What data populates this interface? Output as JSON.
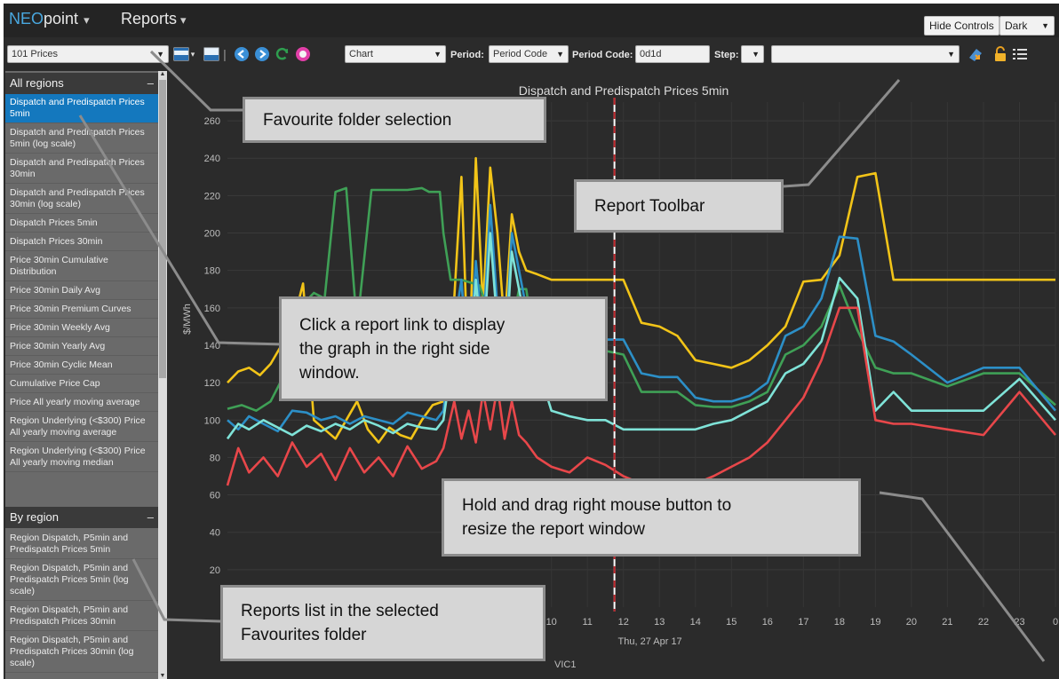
{
  "app": {
    "brand_neo": "NEO",
    "brand_point": "point",
    "reports_menu": "Reports",
    "hide_controls": "Hide Controls",
    "theme": "Dark"
  },
  "toolbar": {
    "folder": "101 Prices",
    "view_select": "Chart",
    "period_label": "Period:",
    "period_value": "Period Code",
    "period_code_label": "Period Code:",
    "period_code_value": "0d1d",
    "step_label": "Step:",
    "step_value": "",
    "region_value": ""
  },
  "sidebar": {
    "all_regions": {
      "title": "All regions",
      "items": [
        "Dispatch and Predispatch Prices 5min",
        "Dispatch and Predispatch Prices 5min (log scale)",
        "Dispatch and Predispatch Prices 30min",
        "Dispatch and Predispatch Prices 30min (log scale)",
        "Dispatch Prices 5min",
        "Dispatch Prices 30min",
        "Price 30min Cumulative Distribution",
        "Price 30min Daily Avg",
        "Price 30min Premium Curves",
        "Price 30min Weekly Avg",
        "Price 30min Yearly Avg",
        "Price 30min Cyclic Mean",
        "Cumulative Price Cap",
        "Price All yearly moving average",
        "Region Underlying (<$300) Price All yearly moving average",
        "Region Underlying (<$300) Price All yearly moving median"
      ]
    },
    "by_region": {
      "title": "By region",
      "items": [
        "Region Dispatch, P5min and Predispatch Prices 5min",
        "Region Dispatch, P5min and Predispatch Prices 5min (log scale)",
        "Region Dispatch, P5min and Predispatch Prices 30min",
        "Region Dispatch, P5min and Predispatch Prices 30min (log scale)"
      ]
    }
  },
  "chart_data": {
    "type": "line",
    "title": "Dispatch and Predispatch Prices 5min",
    "ylabel": "$/MWh",
    "ylim": [
      0,
      270
    ],
    "yticks": [
      20,
      40,
      60,
      80,
      100,
      120,
      140,
      160,
      180,
      200,
      220,
      240,
      260
    ],
    "xlim": [
      1,
      24
    ],
    "xticks": [
      {
        "x": 10,
        "label": "10"
      },
      {
        "x": 11,
        "label": "11"
      },
      {
        "x": 12,
        "label": "12"
      },
      {
        "x": 13,
        "label": "13"
      },
      {
        "x": 14,
        "label": "14"
      },
      {
        "x": 15,
        "label": "15"
      },
      {
        "x": 16,
        "label": "16"
      },
      {
        "x": 17,
        "label": "17"
      },
      {
        "x": 18,
        "label": "18"
      },
      {
        "x": 19,
        "label": "19"
      },
      {
        "x": 20,
        "label": "20"
      },
      {
        "x": 21,
        "label": "21"
      },
      {
        "x": 22,
        "label": "22"
      },
      {
        "x": 23,
        "label": "23"
      },
      {
        "x": 24,
        "label": "0"
      }
    ],
    "date_label": "Thu, 27 Apr 17",
    "footer_label": "VIC1",
    "now_marker_x": 11.75,
    "grid": true,
    "series": [
      {
        "color": "#f2c418",
        "points": [
          [
            1.0,
            120
          ],
          [
            1.3,
            126
          ],
          [
            1.6,
            128
          ],
          [
            1.9,
            124
          ],
          [
            2.2,
            130
          ],
          [
            2.5,
            140
          ],
          [
            2.8,
            150
          ],
          [
            3.1,
            173
          ],
          [
            3.4,
            100
          ],
          [
            3.7,
            95
          ],
          [
            4.0,
            90
          ],
          [
            4.3,
            100
          ],
          [
            4.6,
            110
          ],
          [
            4.9,
            95
          ],
          [
            5.2,
            88
          ],
          [
            5.5,
            96
          ],
          [
            5.8,
            92
          ],
          [
            6.1,
            90
          ],
          [
            6.4,
            100
          ],
          [
            6.7,
            108
          ],
          [
            7.0,
            110
          ],
          [
            7.3,
            165
          ],
          [
            7.5,
            230
          ],
          [
            7.7,
            120
          ],
          [
            7.9,
            240
          ],
          [
            8.1,
            160
          ],
          [
            8.3,
            235
          ],
          [
            8.5,
            200
          ],
          [
            8.7,
            150
          ],
          [
            8.9,
            210
          ],
          [
            9.1,
            190
          ],
          [
            9.3,
            180
          ],
          [
            9.6,
            178
          ],
          [
            10.0,
            175
          ],
          [
            10.5,
            175
          ],
          [
            11.0,
            175
          ],
          [
            11.5,
            175
          ],
          [
            12.0,
            175
          ],
          [
            12.5,
            152
          ],
          [
            13.0,
            150
          ],
          [
            13.5,
            145
          ],
          [
            14.0,
            132
          ],
          [
            14.5,
            130
          ],
          [
            15.0,
            128
          ],
          [
            15.5,
            132
          ],
          [
            16.0,
            140
          ],
          [
            16.5,
            150
          ],
          [
            17.0,
            174
          ],
          [
            17.5,
            175
          ],
          [
            18.0,
            188
          ],
          [
            18.5,
            230
          ],
          [
            19.0,
            232
          ],
          [
            19.5,
            175
          ],
          [
            20.0,
            175
          ],
          [
            21.0,
            175
          ],
          [
            22.0,
            175
          ],
          [
            23.0,
            175
          ],
          [
            24.0,
            175
          ]
        ]
      },
      {
        "color": "#3fa056",
        "points": [
          [
            1.0,
            106
          ],
          [
            1.4,
            108
          ],
          [
            1.8,
            105
          ],
          [
            2.2,
            110
          ],
          [
            2.6,
            125
          ],
          [
            3.0,
            160
          ],
          [
            3.4,
            168
          ],
          [
            3.7,
            165
          ],
          [
            4.0,
            222
          ],
          [
            4.3,
            224
          ],
          [
            4.6,
            150
          ],
          [
            5.0,
            223
          ],
          [
            5.5,
            223
          ],
          [
            6.0,
            223
          ],
          [
            6.4,
            224
          ],
          [
            6.6,
            222
          ],
          [
            6.9,
            222
          ],
          [
            7.0,
            200
          ],
          [
            7.2,
            175
          ],
          [
            7.5,
            175
          ],
          [
            8.0,
            172
          ],
          [
            8.3,
            155
          ],
          [
            8.7,
            130
          ],
          [
            9.1,
            170
          ],
          [
            9.3,
            170
          ],
          [
            9.5,
            145
          ],
          [
            9.8,
            140
          ],
          [
            10.2,
            140
          ],
          [
            10.6,
            140
          ],
          [
            11.0,
            137
          ],
          [
            11.5,
            137
          ],
          [
            12.0,
            135
          ],
          [
            12.5,
            115
          ],
          [
            13.0,
            115
          ],
          [
            13.5,
            115
          ],
          [
            14.0,
            108
          ],
          [
            14.5,
            107
          ],
          [
            15.0,
            107
          ],
          [
            15.5,
            110
          ],
          [
            16.0,
            115
          ],
          [
            16.5,
            135
          ],
          [
            17.0,
            140
          ],
          [
            17.5,
            150
          ],
          [
            18.0,
            172
          ],
          [
            18.5,
            148
          ],
          [
            19.0,
            128
          ],
          [
            19.5,
            125
          ],
          [
            20.0,
            125
          ],
          [
            21.0,
            118
          ],
          [
            22.0,
            125
          ],
          [
            23.0,
            125
          ],
          [
            24.0,
            108
          ]
        ]
      },
      {
        "color": "#2c8fc7",
        "points": [
          [
            1.0,
            100
          ],
          [
            1.3,
            95
          ],
          [
            1.6,
            102
          ],
          [
            2.0,
            98
          ],
          [
            2.4,
            94
          ],
          [
            2.8,
            105
          ],
          [
            3.2,
            104
          ],
          [
            3.6,
            100
          ],
          [
            4.0,
            102
          ],
          [
            4.4,
            98
          ],
          [
            4.8,
            102
          ],
          [
            5.2,
            100
          ],
          [
            5.6,
            98
          ],
          [
            6.0,
            104
          ],
          [
            6.4,
            102
          ],
          [
            6.8,
            100
          ],
          [
            7.0,
            105
          ],
          [
            7.3,
            150
          ],
          [
            7.5,
            175
          ],
          [
            7.7,
            120
          ],
          [
            7.9,
            185
          ],
          [
            8.1,
            145
          ],
          [
            8.3,
            215
          ],
          [
            8.5,
            160
          ],
          [
            8.7,
            130
          ],
          [
            8.9,
            200
          ],
          [
            9.1,
            180
          ],
          [
            9.3,
            160
          ],
          [
            9.6,
            140
          ],
          [
            10.0,
            145
          ],
          [
            10.5,
            148
          ],
          [
            11.0,
            143
          ],
          [
            11.5,
            143
          ],
          [
            12.0,
            143
          ],
          [
            12.5,
            125
          ],
          [
            13.0,
            123
          ],
          [
            13.5,
            123
          ],
          [
            14.0,
            112
          ],
          [
            14.5,
            110
          ],
          [
            15.0,
            110
          ],
          [
            15.5,
            113
          ],
          [
            16.0,
            120
          ],
          [
            16.5,
            145
          ],
          [
            17.0,
            150
          ],
          [
            17.5,
            165
          ],
          [
            18.0,
            198
          ],
          [
            18.5,
            197
          ],
          [
            19.0,
            145
          ],
          [
            19.5,
            142
          ],
          [
            20.0,
            135
          ],
          [
            21.0,
            120
          ],
          [
            22.0,
            128
          ],
          [
            23.0,
            128
          ],
          [
            24.0,
            105
          ]
        ]
      },
      {
        "color": "#7fe3d8",
        "points": [
          [
            1.0,
            90
          ],
          [
            1.3,
            98
          ],
          [
            1.6,
            95
          ],
          [
            2.0,
            100
          ],
          [
            2.4,
            96
          ],
          [
            2.8,
            92
          ],
          [
            3.2,
            97
          ],
          [
            3.6,
            94
          ],
          [
            4.0,
            98
          ],
          [
            4.4,
            95
          ],
          [
            4.8,
            100
          ],
          [
            5.2,
            97
          ],
          [
            5.6,
            93
          ],
          [
            6.0,
            98
          ],
          [
            6.4,
            96
          ],
          [
            6.8,
            95
          ],
          [
            7.0,
            100
          ],
          [
            7.3,
            140
          ],
          [
            7.5,
            160
          ],
          [
            7.7,
            115
          ],
          [
            7.9,
            175
          ],
          [
            8.1,
            135
          ],
          [
            8.3,
            200
          ],
          [
            8.5,
            150
          ],
          [
            8.7,
            125
          ],
          [
            8.9,
            190
          ],
          [
            9.1,
            170
          ],
          [
            9.3,
            150
          ],
          [
            9.6,
            130
          ],
          [
            10.0,
            105
          ],
          [
            10.5,
            102
          ],
          [
            11.0,
            100
          ],
          [
            11.5,
            100
          ],
          [
            12.0,
            95
          ],
          [
            12.5,
            95
          ],
          [
            13.0,
            95
          ],
          [
            13.5,
            95
          ],
          [
            14.0,
            95
          ],
          [
            14.5,
            98
          ],
          [
            15.0,
            100
          ],
          [
            15.5,
            105
          ],
          [
            16.0,
            110
          ],
          [
            16.5,
            125
          ],
          [
            17.0,
            130
          ],
          [
            17.5,
            142
          ],
          [
            18.0,
            176
          ],
          [
            18.5,
            165
          ],
          [
            19.0,
            105
          ],
          [
            19.5,
            115
          ],
          [
            20.0,
            105
          ],
          [
            21.0,
            105
          ],
          [
            22.0,
            105
          ],
          [
            23.0,
            122
          ],
          [
            24.0,
            100
          ]
        ]
      },
      {
        "color": "#e8474a",
        "points": [
          [
            1.0,
            65
          ],
          [
            1.3,
            85
          ],
          [
            1.6,
            72
          ],
          [
            2.0,
            80
          ],
          [
            2.4,
            70
          ],
          [
            2.8,
            88
          ],
          [
            3.2,
            75
          ],
          [
            3.6,
            82
          ],
          [
            4.0,
            68
          ],
          [
            4.4,
            85
          ],
          [
            4.8,
            72
          ],
          [
            5.2,
            80
          ],
          [
            5.6,
            70
          ],
          [
            6.0,
            86
          ],
          [
            6.4,
            74
          ],
          [
            6.8,
            78
          ],
          [
            7.0,
            85
          ],
          [
            7.3,
            110
          ],
          [
            7.5,
            90
          ],
          [
            7.7,
            105
          ],
          [
            7.9,
            88
          ],
          [
            8.1,
            115
          ],
          [
            8.3,
            95
          ],
          [
            8.5,
            118
          ],
          [
            8.7,
            90
          ],
          [
            8.9,
            110
          ],
          [
            9.1,
            92
          ],
          [
            9.3,
            88
          ],
          [
            9.6,
            80
          ],
          [
            10.0,
            75
          ],
          [
            10.5,
            72
          ],
          [
            11.0,
            80
          ],
          [
            11.5,
            76
          ],
          [
            12.0,
            70
          ],
          [
            12.5,
            66
          ],
          [
            13.0,
            62
          ],
          [
            13.5,
            64
          ],
          [
            14.0,
            66
          ],
          [
            14.5,
            70
          ],
          [
            15.0,
            75
          ],
          [
            15.5,
            80
          ],
          [
            16.0,
            88
          ],
          [
            16.5,
            100
          ],
          [
            17.0,
            112
          ],
          [
            17.5,
            132
          ],
          [
            18.0,
            160
          ],
          [
            18.5,
            160
          ],
          [
            19.0,
            100
          ],
          [
            19.5,
            98
          ],
          [
            20.0,
            98
          ],
          [
            21.0,
            95
          ],
          [
            22.0,
            92
          ],
          [
            23.0,
            115
          ],
          [
            24.0,
            92
          ]
        ]
      }
    ]
  },
  "callouts": {
    "favourite_folder": "Favourite folder selection",
    "report_toolbar": "Report Toolbar",
    "report_link_1": "Click a report link to display",
    "report_link_2": "the graph in the right side",
    "report_link_3": "window.",
    "resize_1": "Hold and drag right mouse button to",
    "resize_2": "resize the report window",
    "reports_list_1": "Reports list in the selected",
    "reports_list_2": "Favourites folder"
  },
  "colors": {
    "accent": "#1478be",
    "background": "#2b2b2b",
    "sidebar": "#6a6a6a"
  },
  "icons": [
    "chart-type-icon",
    "export-icon",
    "back-arrow-icon",
    "forward-arrow-icon",
    "refresh-icon",
    "record-icon",
    "download-icon",
    "lock-icon",
    "list-icon"
  ]
}
